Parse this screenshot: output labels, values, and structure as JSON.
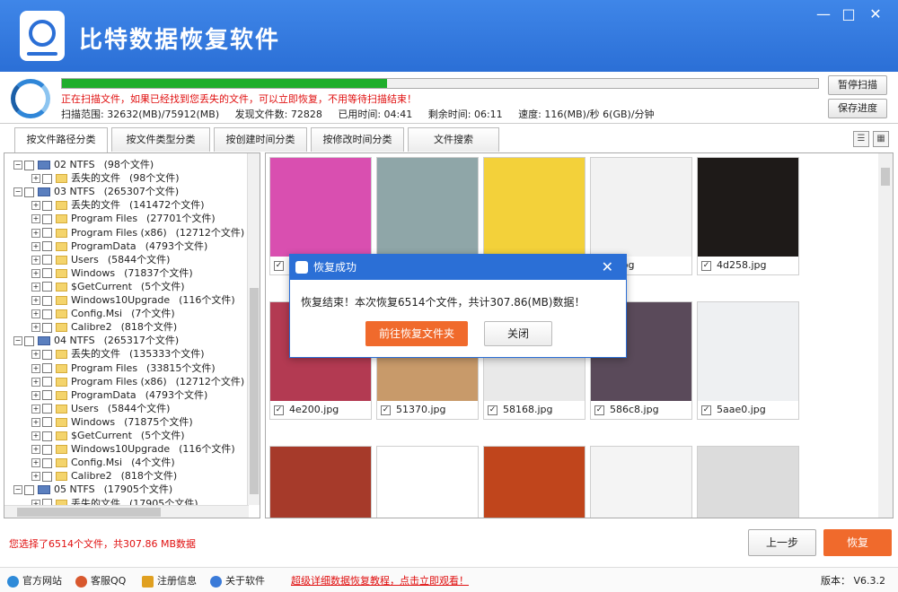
{
  "app": {
    "title": "比特数据恢复软件"
  },
  "scan": {
    "progress": 0.43,
    "message": "正在扫描文件，如果已经找到您丢失的文件，可以立即恢复，不用等待扫描结束！",
    "range": "扫描范围: 32632(MB)/75912(MB)",
    "found": "发现文件数: 72828",
    "elapsed": "已用时间: 04:41",
    "remaining": "剩余时间: 06:11",
    "speed": "速度: 116(MB)/秒 6(GB)/分钟",
    "pause_label": "暂停扫描",
    "save_label": "保存进度"
  },
  "tabs": [
    "按文件路径分类",
    "按文件类型分类",
    "按创建时间分类",
    "按修改时间分类",
    "文件搜索"
  ],
  "tree": [
    {
      "label": "02  NTFS",
      "count": "(98个文件)",
      "kind": "drive",
      "level": 0
    },
    {
      "label": "丢失的文件",
      "count": "(98个文件)",
      "kind": "folder",
      "level": 1
    },
    {
      "label": "03  NTFS",
      "count": "(265307个文件)",
      "kind": "drive",
      "level": 0
    },
    {
      "label": "丢失的文件",
      "count": "(141472个文件)",
      "kind": "folder",
      "level": 1
    },
    {
      "label": "Program Files",
      "count": "(27701个文件)",
      "kind": "folder",
      "level": 1
    },
    {
      "label": "Program Files (x86)",
      "count": "(12712个文件)",
      "kind": "folder",
      "level": 1
    },
    {
      "label": "ProgramData",
      "count": "(4793个文件)",
      "kind": "folder",
      "level": 1
    },
    {
      "label": "Users",
      "count": "(5844个文件)",
      "kind": "folder",
      "level": 1
    },
    {
      "label": "Windows",
      "count": "(71837个文件)",
      "kind": "folder",
      "level": 1
    },
    {
      "label": "$GetCurrent",
      "count": "(5个文件)",
      "kind": "folder",
      "level": 1
    },
    {
      "label": "Windows10Upgrade",
      "count": "(116个文件)",
      "kind": "folder",
      "level": 1
    },
    {
      "label": "Config.Msi",
      "count": "(7个文件)",
      "kind": "folder",
      "level": 1
    },
    {
      "label": "Calibre2",
      "count": "(818个文件)",
      "kind": "folder",
      "level": 1
    },
    {
      "label": "04  NTFS",
      "count": "(265317个文件)",
      "kind": "drive",
      "level": 0
    },
    {
      "label": "丢失的文件",
      "count": "(135333个文件)",
      "kind": "folder",
      "level": 1
    },
    {
      "label": "Program Files",
      "count": "(33815个文件)",
      "kind": "folder",
      "level": 1
    },
    {
      "label": "Program Files (x86)",
      "count": "(12712个文件)",
      "kind": "folder",
      "level": 1
    },
    {
      "label": "ProgramData",
      "count": "(4793个文件)",
      "kind": "folder",
      "level": 1
    },
    {
      "label": "Users",
      "count": "(5844个文件)",
      "kind": "folder",
      "level": 1
    },
    {
      "label": "Windows",
      "count": "(71875个文件)",
      "kind": "folder",
      "level": 1
    },
    {
      "label": "$GetCurrent",
      "count": "(5个文件)",
      "kind": "folder",
      "level": 1
    },
    {
      "label": "Windows10Upgrade",
      "count": "(116个文件)",
      "kind": "folder",
      "level": 1
    },
    {
      "label": "Config.Msi",
      "count": "(4个文件)",
      "kind": "folder",
      "level": 1
    },
    {
      "label": "Calibre2",
      "count": "(818个文件)",
      "kind": "folder",
      "level": 1
    },
    {
      "label": "05  NTFS",
      "count": "(17905个文件)",
      "kind": "drive",
      "level": 0
    },
    {
      "label": "丢失的文件",
      "count": "(17905个文件)",
      "kind": "folder",
      "level": 1
    }
  ],
  "files": [
    {
      "name": "",
      "color": "#d94fb0"
    },
    {
      "name": "",
      "color": "#8fa6a8"
    },
    {
      "name": "",
      "color": "#f3d13a"
    },
    {
      "name": "0.jpg",
      "color": "#f2f2f2"
    },
    {
      "name": "4d258.jpg",
      "color": "#1e1a18"
    },
    {
      "name": "4e200.jpg",
      "color": "#b33a52"
    },
    {
      "name": "51370.jpg",
      "color": "#c89a6a"
    },
    {
      "name": "58168.jpg",
      "color": "#e9e9e9"
    },
    {
      "name": "586c8.jpg",
      "color": "#5a4a5a"
    },
    {
      "name": "5aae0.jpg",
      "color": "#eef0f2"
    },
    {
      "name": "",
      "color": "#a63a2a"
    },
    {
      "name": "",
      "color": "#ffffff"
    },
    {
      "name": "",
      "color": "#c0451c"
    },
    {
      "name": "",
      "color": "#f4f4f4"
    },
    {
      "name": "",
      "color": "#dcdcdc"
    }
  ],
  "dialog": {
    "title": "恢复成功",
    "message": "恢复结束！本次恢复6514个文件，共计307.86(MB)数据！",
    "goto_label": "前往恢复文件夹",
    "close_label": "关闭"
  },
  "selection": "您选择了6514个文件，共307.86 MB数据",
  "nav": {
    "back_label": "上一步",
    "recover_label": "恢复"
  },
  "footer": {
    "links": [
      "官方网站",
      "客服QQ",
      "注册信息",
      "关于软件"
    ],
    "promo": "超级详细数据恢复教程，点击立即观看！",
    "version": "版本： V6.3.2"
  }
}
